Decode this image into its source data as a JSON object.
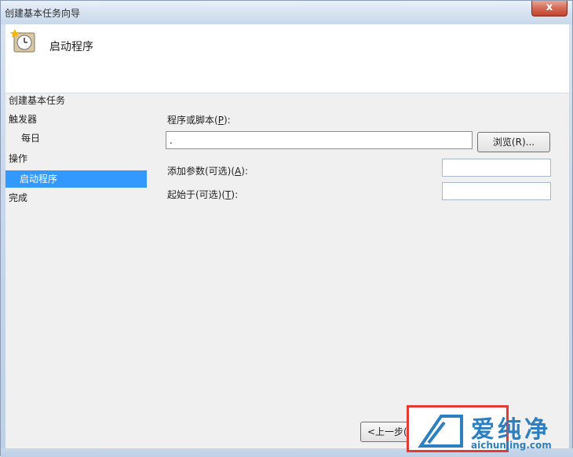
{
  "window": {
    "title": "创建基本任务向导",
    "close_label": "x"
  },
  "header": {
    "title": "启动程序",
    "icon": "clock-task-icon"
  },
  "nav": {
    "heading": "创建基本任务",
    "items": [
      {
        "label": "触发器",
        "level": 0,
        "selected": false
      },
      {
        "label": "每日",
        "level": 1,
        "selected": false
      },
      {
        "label": "操作",
        "level": 0,
        "selected": false
      },
      {
        "label": "启动程序",
        "level": 1,
        "selected": true
      },
      {
        "label": "完成",
        "level": 0,
        "selected": false
      }
    ]
  },
  "form": {
    "program_label": "程序或脚本(",
    "program_key": "P",
    "program_suffix": "):",
    "program_value": ".",
    "browse_label": "浏览(R)...",
    "args_label": "添加参数(可选)(",
    "args_key": "A",
    "args_suffix": "):",
    "args_value": "",
    "start_label": "起始于(可选)(",
    "start_key": "T",
    "start_suffix": "):",
    "start_value": ""
  },
  "footer": {
    "back_label": "<上一步(B)"
  },
  "watermark": {
    "text": "爱纯净",
    "url": "aichunjing.com"
  },
  "colors": {
    "selection": "#3399ff",
    "highlight": "#e53935",
    "watermark": "#2c7fc0"
  }
}
